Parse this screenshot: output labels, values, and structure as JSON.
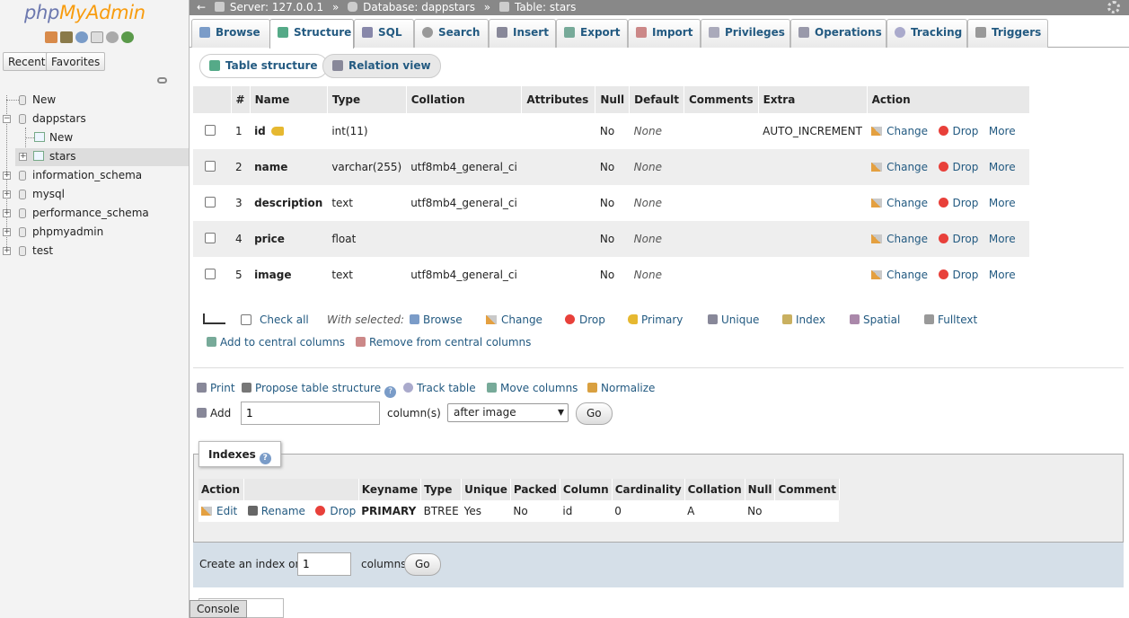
{
  "nav": {
    "logo_a": "php",
    "logo_b": "MyAdmin",
    "tab_recent": "Recent",
    "tab_favorites": "Favorites",
    "tree": [
      {
        "label": "New"
      },
      {
        "label": "dappstars"
      },
      {
        "label": "New"
      },
      {
        "label": "stars"
      },
      {
        "label": "information_schema"
      },
      {
        "label": "mysql"
      },
      {
        "label": "performance_schema"
      },
      {
        "label": "phpmyadmin"
      },
      {
        "label": "test"
      }
    ]
  },
  "breadcrumb": {
    "back": "←",
    "server": "Server: 127.0.0.1",
    "sep1": "»",
    "database": "Database: dappstars",
    "sep2": "»",
    "table": "Table: stars"
  },
  "tabs": [
    {
      "label": "Browse",
      "color": "#7b9cc8"
    },
    {
      "label": "Structure",
      "color": "#5a8"
    },
    {
      "label": "SQL",
      "color": "#88a"
    },
    {
      "label": "Search",
      "color": "#999"
    },
    {
      "label": "Insert",
      "color": "#889"
    },
    {
      "label": "Export",
      "color": "#7a9"
    },
    {
      "label": "Import",
      "color": "#c88"
    },
    {
      "label": "Privileges",
      "color": "#aab"
    },
    {
      "label": "Operations",
      "color": "#99a"
    },
    {
      "label": "Tracking",
      "color": "#aac"
    },
    {
      "label": "Triggers",
      "color": "#999"
    }
  ],
  "subtabs": {
    "table_structure": "Table structure",
    "relation_view": "Relation view"
  },
  "columns_header": [
    "",
    "#",
    "Name",
    "Type",
    "Collation",
    "Attributes",
    "Null",
    "Default",
    "Comments",
    "Extra",
    "Action"
  ],
  "rows": [
    {
      "num": "1",
      "name": "id",
      "type": "int(11)",
      "collation": "",
      "nul": "No",
      "def": "None",
      "extra": "AUTO_INCREMENT"
    },
    {
      "num": "2",
      "name": "name",
      "type": "varchar(255)",
      "collation": "utf8mb4_general_ci",
      "nul": "No",
      "def": "None",
      "extra": ""
    },
    {
      "num": "3",
      "name": "description",
      "type": "text",
      "collation": "utf8mb4_general_ci",
      "nul": "No",
      "def": "None",
      "extra": ""
    },
    {
      "num": "4",
      "name": "price",
      "type": "float",
      "collation": "",
      "nul": "No",
      "def": "None",
      "extra": ""
    },
    {
      "num": "5",
      "name": "image",
      "type": "text",
      "collation": "utf8mb4_general_ci",
      "nul": "No",
      "def": "None",
      "extra": ""
    }
  ],
  "row_actions": {
    "change": "Change",
    "drop": "Drop",
    "more": "More"
  },
  "with_selected": {
    "check_all": "Check all",
    "label": "With selected:",
    "browse": "Browse",
    "change": "Change",
    "drop": "Drop",
    "primary": "Primary",
    "unique": "Unique",
    "index": "Index",
    "spatial": "Spatial",
    "fulltext": "Fulltext",
    "add_central": "Add to central columns",
    "remove_central": "Remove from central columns"
  },
  "tools": {
    "print": "Print",
    "propose": "Propose table structure",
    "track": "Track table",
    "move": "Move columns",
    "normalize": "Normalize"
  },
  "add_columns": {
    "label": "Add",
    "value": "1",
    "unit": "column(s)",
    "position": "after image",
    "go": "Go"
  },
  "indexes": {
    "title": "Indexes",
    "header": [
      "Action",
      "",
      "Keyname",
      "Type",
      "Unique",
      "Packed",
      "Column",
      "Cardinality",
      "Collation",
      "Null",
      "Comment"
    ],
    "actions": {
      "edit": "Edit",
      "rename": "Rename",
      "drop": "Drop"
    },
    "row": {
      "keyname": "PRIMARY",
      "type": "BTREE",
      "unique": "Yes",
      "packed": "No",
      "column": "id",
      "cardinality": "0",
      "collation": "A",
      "nul": "No",
      "comment": ""
    },
    "create_label": "Create an index on",
    "create_value": "1",
    "create_unit": "columns",
    "go": "Go"
  },
  "console": "Console"
}
